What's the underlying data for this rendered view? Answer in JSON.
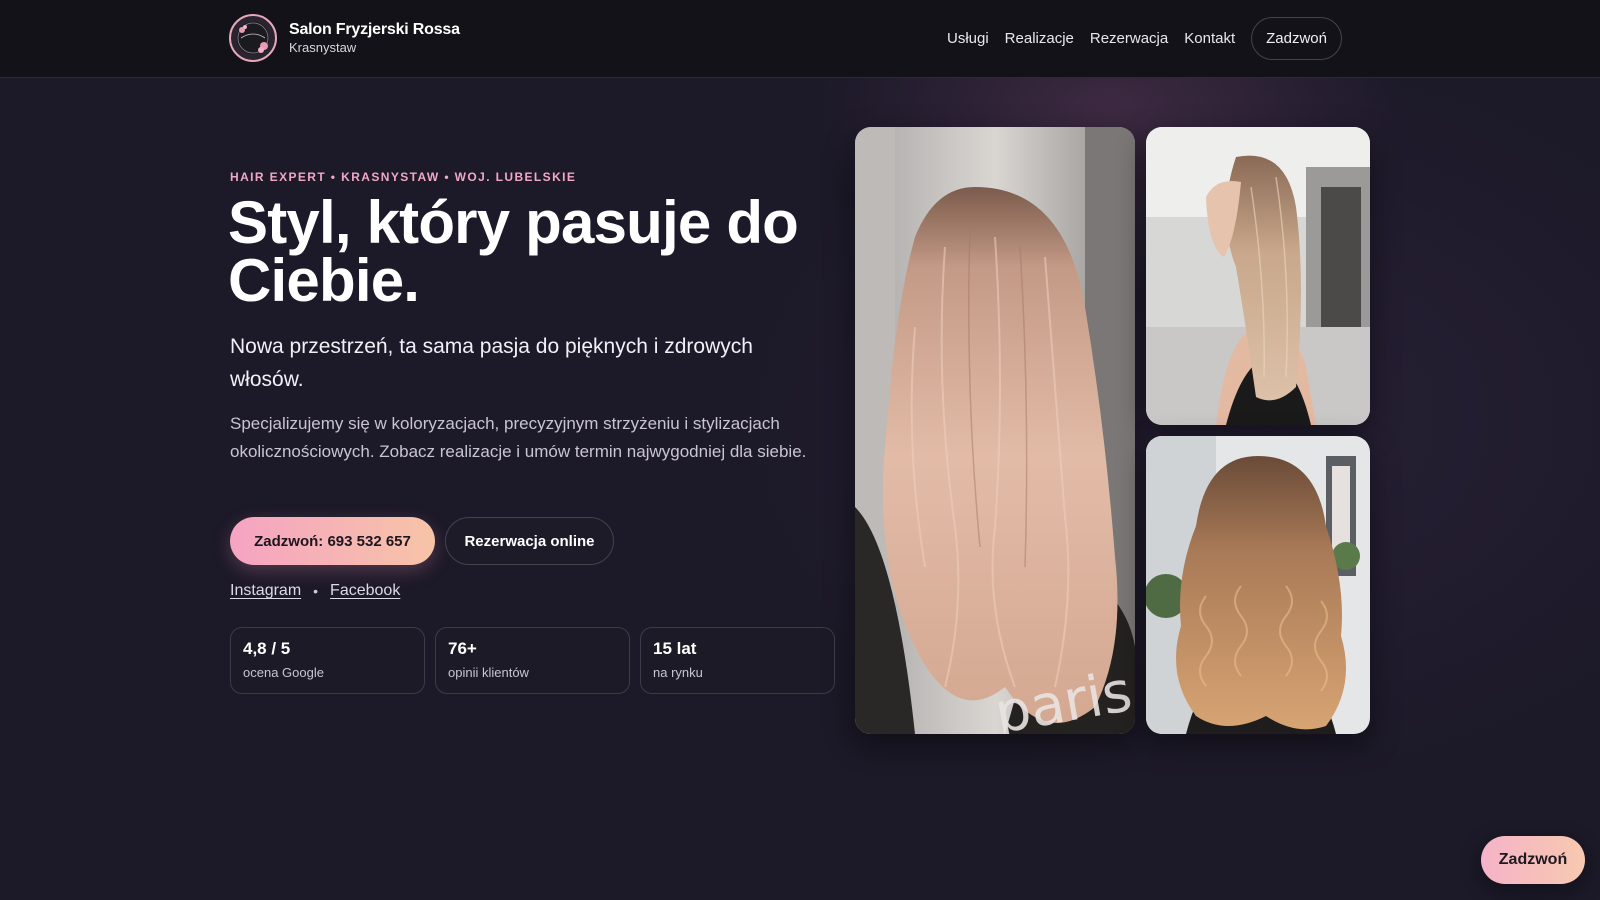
{
  "header": {
    "brand_name": "Salon Fryzjerski Rossa",
    "brand_city": "Krasnystaw",
    "nav": [
      "Usługi",
      "Realizacje",
      "Rezerwacja",
      "Kontakt"
    ],
    "call_label": "Zadzwoń"
  },
  "hero": {
    "eyebrow": "HAIR EXPERT • KRASNYSTAW • WOJ. LUBELSKIE",
    "title": "Styl, który pasuje do Ciebie.",
    "subtitle": "Nowa przestrzeń, ta sama pasja do pięknych i zdrowych włosów.",
    "description": "Specjalizujemy się w koloryzacjach, precyzyjnym strzyżeniu i stylizacjach okolicznościowych. Zobacz realizacje i umów termin najwygodniej dla siebie.",
    "primary_button": "Zadzwoń: 693 532 657",
    "secondary_button": "Rezerwacja online",
    "social": {
      "instagram": "Instagram",
      "separator": "•",
      "facebook": "Facebook"
    },
    "stats": [
      {
        "value": "4,8 / 5",
        "label": "ocena Google"
      },
      {
        "value": "76+",
        "label": "opinii klientów"
      },
      {
        "value": "15 lat",
        "label": "na rynku"
      }
    ]
  },
  "floating_call": "Zadzwoń",
  "colors": {
    "background": "#1c1928",
    "header": "#141219",
    "accent_pink": "#f0a8c4",
    "button_gradient_start": "#f5a3c2",
    "button_gradient_end": "#f7c4a7"
  }
}
